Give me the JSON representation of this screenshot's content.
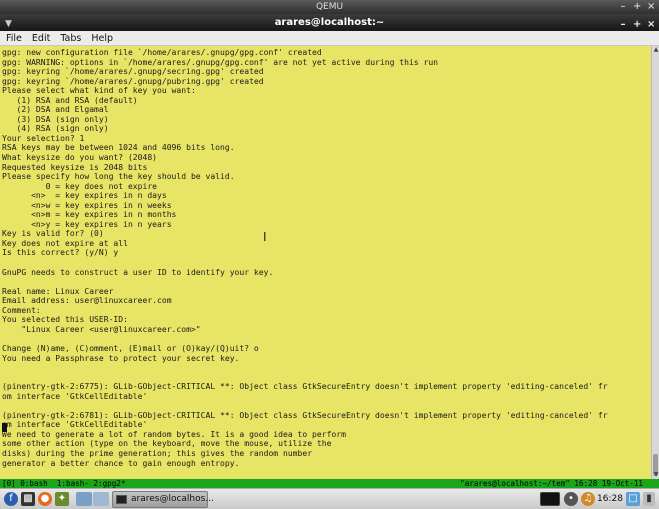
{
  "qemu": {
    "title": "QEMU"
  },
  "window": {
    "title": "arares@localhost:~",
    "controls": [
      "–",
      "+",
      "×"
    ]
  },
  "menu": [
    "File",
    "Edit",
    "Tabs",
    "Help"
  ],
  "terminal_lines": [
    "gpg: new configuration file `/home/arares/.gnupg/gpg.conf' created",
    "gpg: WARNING: options in `/home/arares/.gnupg/gpg.conf' are not yet active during this run",
    "gpg: keyring `/home/arares/.gnupg/secring.gpg' created",
    "gpg: keyring `/home/arares/.gnupg/pubring.gpg' created",
    "Please select what kind of key you want:",
    "   (1) RSA and RSA (default)",
    "   (2) DSA and Elgamal",
    "   (3) DSA (sign only)",
    "   (4) RSA (sign only)",
    "Your selection? 1",
    "RSA keys may be between 1024 and 4096 bits long.",
    "What keysize do you want? (2048)",
    "Requested keysize is 2048 bits",
    "Please specify how long the key should be valid.",
    "         0 = key does not expire",
    "      <n>  = key expires in n days",
    "      <n>w = key expires in n weeks",
    "      <n>m = key expires in n months",
    "      <n>y = key expires in n years",
    "Key is valid for? (0)",
    "Key does not expire at all",
    "Is this correct? (y/N) y",
    "",
    "GnuPG needs to construct a user ID to identify your key.",
    "",
    "Real name: Linux Career",
    "Email address: user@linuxcareer.com",
    "Comment:",
    "You selected this USER-ID:",
    "    \"Linux Career <user@linuxcareer.com>\"",
    "",
    "Change (N)ame, (C)omment, (E)mail or (O)kay/(Q)uit? o",
    "You need a Passphrase to protect your secret key.",
    "",
    "",
    "(pinentry-gtk-2:6775): GLib-GObject-CRITICAL **: Object class GtkSecureEntry doesn't implement property 'editing-canceled' fr",
    "om interface 'GtkCellEditable'",
    "",
    "(pinentry-gtk-2:6781): GLib-GObject-CRITICAL **: Object class GtkSecureEntry doesn't implement property 'editing-canceled' fr",
    "om interface 'GtkCellEditable'",
    "We need to generate a lot of random bytes. It is a good idea to perform",
    "some other action (type on the keyboard, move the mouse, utilize the",
    "disks) during the prime generation; this gives the random number",
    "generator a better chance to gain enough entropy.",
    ""
  ],
  "status": {
    "left": "[0] 0:bash  1:bash- 2:gpg2*",
    "right": "\"arares@localhost:~/tem\" 16:28 19-Oct-11"
  },
  "taskbar": {
    "task_label": "arares@localhos...",
    "clock": "16:28",
    "icons": [
      "fedora-icon",
      "terminal-icon",
      "firefox-icon",
      "applications-icon",
      "workspace-icon"
    ]
  },
  "colors": {
    "terminal_bg": "#e8e466",
    "status_bg": "#1aa51a"
  }
}
